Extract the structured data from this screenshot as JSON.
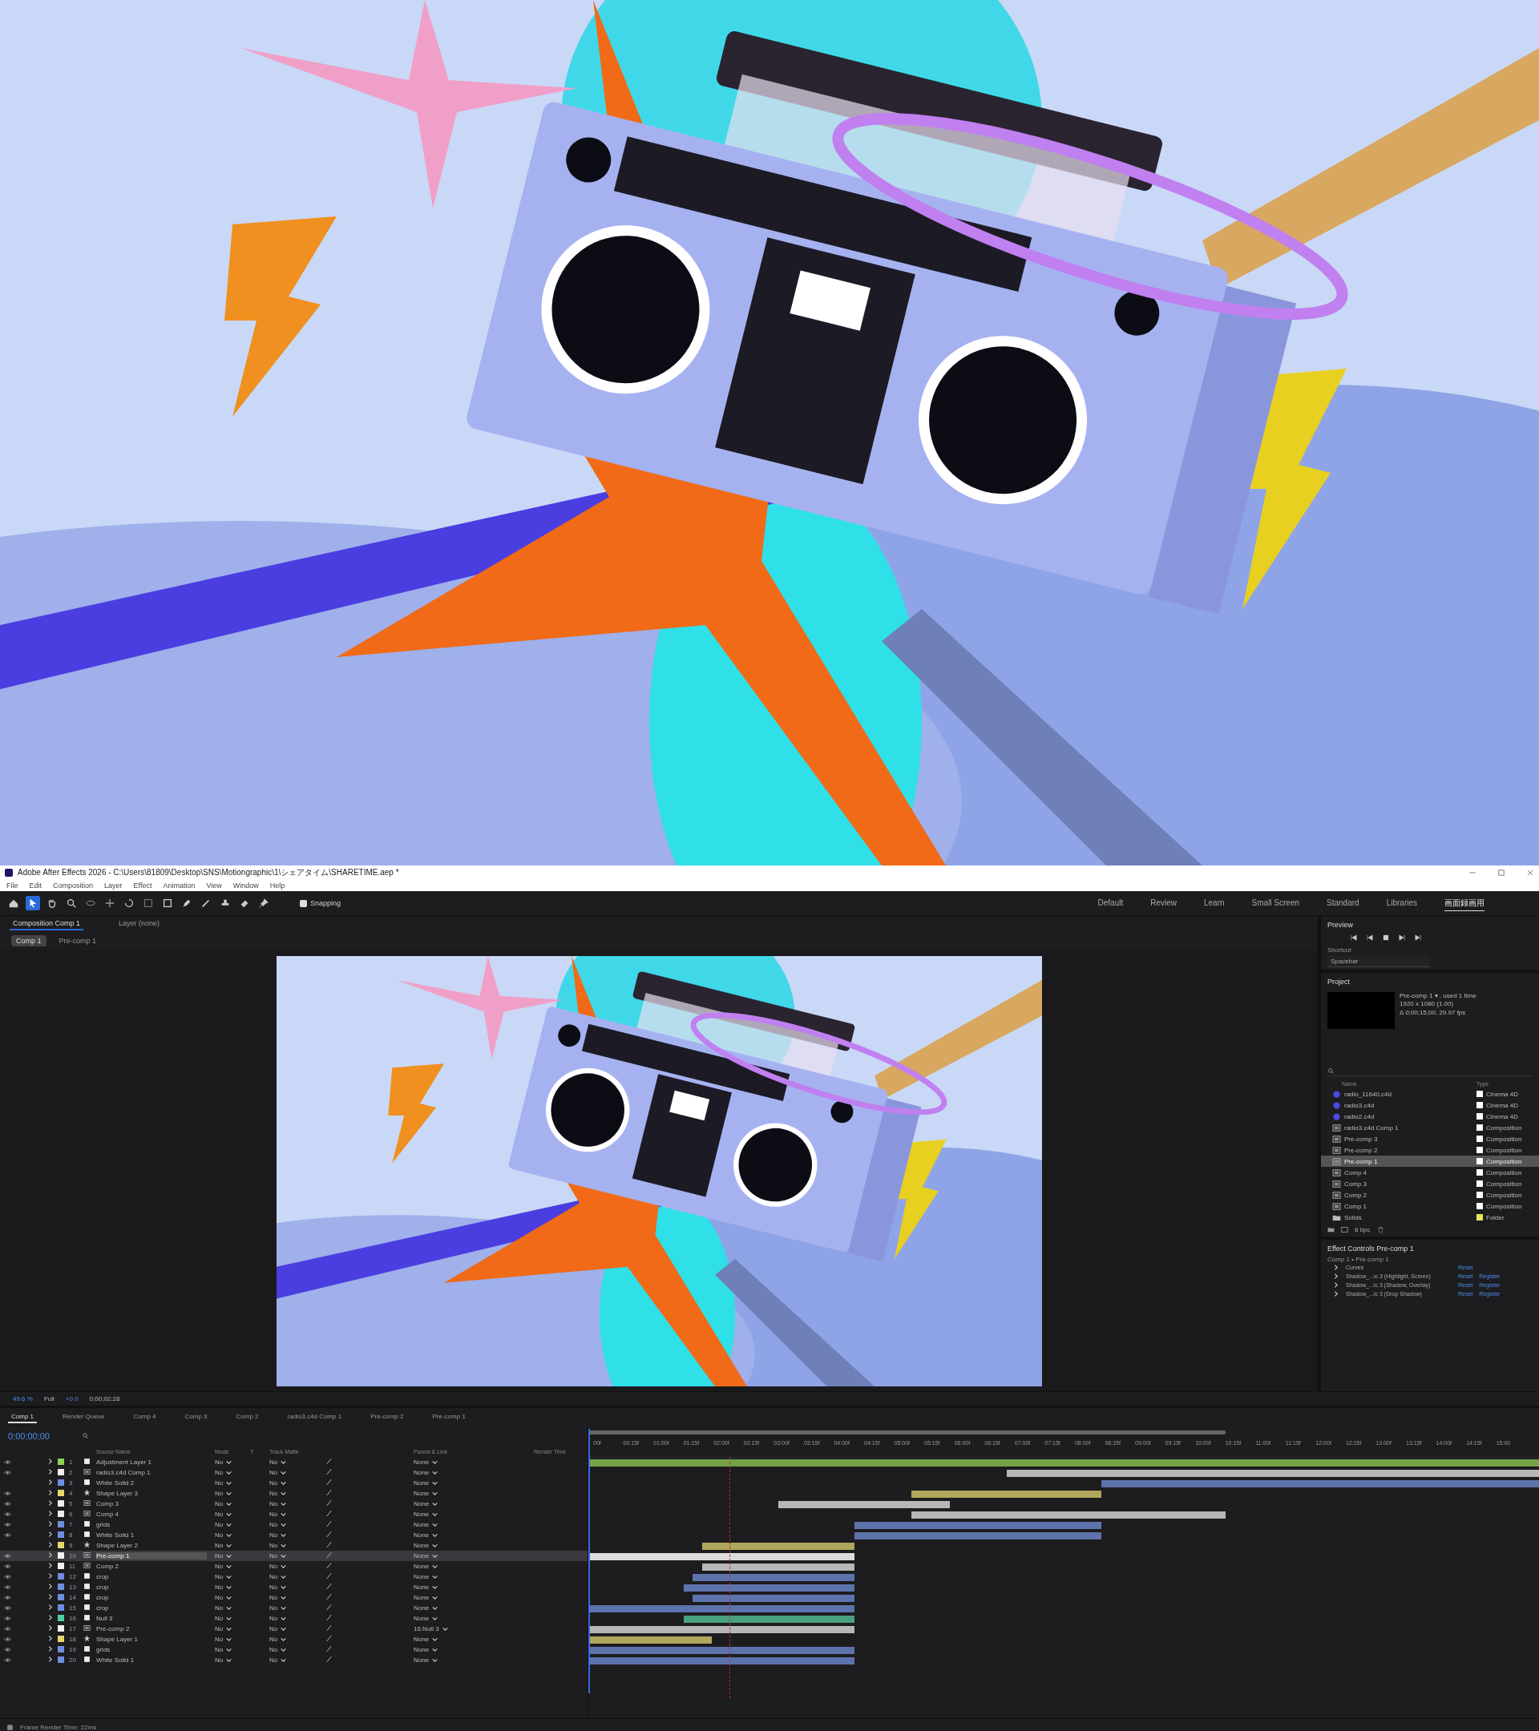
{
  "title_bar": {
    "app_title": "Adobe After Effects 2026 - C:\\Users\\81809\\Desktop\\SNS\\Motiongraphic\\1\\シェアタイム\\SHARETIME.aep *"
  },
  "menu": [
    "File",
    "Edit",
    "Composition",
    "Layer",
    "Effect",
    "Animation",
    "View",
    "Window",
    "Help"
  ],
  "toolbar": {
    "snapping": {
      "label": "Snapping",
      "checked": true
    }
  },
  "workspaces": [
    {
      "label": "Default",
      "selected": false
    },
    {
      "label": "Review",
      "selected": false
    },
    {
      "label": "Learn",
      "selected": false
    },
    {
      "label": "Small Screen",
      "selected": false
    },
    {
      "label": "Standard",
      "selected": false
    },
    {
      "label": "Libraries",
      "selected": false
    },
    {
      "label": "画面録画用",
      "selected": true
    }
  ],
  "composition_panel": {
    "tabs": [
      {
        "label": "Composition Comp 1",
        "selected": true
      },
      {
        "label": "Layer (none)",
        "selected": false
      }
    ],
    "breadcrumbs": [
      {
        "label": "Comp 1",
        "selected": true
      },
      {
        "label": "Pre-comp 1",
        "selected": false
      }
    ],
    "zoom": "49.6 %",
    "resolution": "Full",
    "exposure": "+0.0",
    "timecode": "0;00;02;28"
  },
  "preview_panel": {
    "title": "Preview",
    "shortcut_label": "Shortcut",
    "shortcut": "Spacebar"
  },
  "project_panel": {
    "title": "Project",
    "info": [
      "Pre-comp 1 ▾ , used 1 time",
      "1920 x 1080 (1.00)",
      "Δ 0;00;15;00, 29.97 fps"
    ],
    "columns": [
      "Name",
      "Type"
    ],
    "items": [
      {
        "name": "radio_11640.c4d",
        "type": "Cinema 4D",
        "kind": "c4d",
        "color": "#ffffff",
        "selected": false
      },
      {
        "name": "radio3.c4d",
        "type": "Cinema 4D",
        "kind": "c4d",
        "color": "#ffffff",
        "selected": false
      },
      {
        "name": "radio2.c4d",
        "type": "Cinema 4D",
        "kind": "c4d",
        "color": "#ffffff",
        "selected": false
      },
      {
        "name": "radio3.c4d Comp 1",
        "type": "Composition",
        "kind": "comp",
        "color": "#ffffff",
        "selected": false
      },
      {
        "name": "Pre-comp 3",
        "type": "Composition",
        "kind": "comp",
        "color": "#ffffff",
        "selected": false
      },
      {
        "name": "Pre-comp 2",
        "type": "Composition",
        "kind": "comp",
        "color": "#ffffff",
        "selected": false
      },
      {
        "name": "Pre-comp 1",
        "type": "Composition",
        "kind": "comp",
        "color": "#ffffff",
        "selected": true
      },
      {
        "name": "Comp 4",
        "type": "Composition",
        "kind": "comp",
        "color": "#ffffff",
        "selected": false
      },
      {
        "name": "Comp 3",
        "type": "Composition",
        "kind": "comp",
        "color": "#ffffff",
        "selected": false
      },
      {
        "name": "Comp 2",
        "type": "Composition",
        "kind": "comp",
        "color": "#ffffff",
        "selected": false
      },
      {
        "name": "Comp 1",
        "type": "Composition",
        "kind": "comp",
        "color": "#ffffff",
        "selected": false
      },
      {
        "name": "Solids",
        "type": "Folder",
        "kind": "folder",
        "color": "#e8e85a",
        "selected": false
      }
    ],
    "bpc": "8 bpc"
  },
  "effect_controls": {
    "title": "Effect Controls Pre-comp 1",
    "path": "Comp 1 • Pre-comp 1",
    "effects": [
      {
        "name": "Curves",
        "actions": [
          "Reset"
        ]
      },
      {
        "name": "Shadow_...ic 3 (Highlight, Screen)",
        "actions": [
          "Reset",
          "Register"
        ]
      },
      {
        "name": "Shadow_...ic 3 (Shadow, Overlay)",
        "actions": [
          "Reset",
          "Register"
        ]
      },
      {
        "name": "Shadow_...ic 3 (Drop Shadow)",
        "actions": [
          "Reset",
          "Register"
        ]
      }
    ]
  },
  "timeline": {
    "tabs": [
      {
        "label": "Comp 1",
        "selected": true
      },
      {
        "label": "Render Queue",
        "selected": false
      },
      {
        "label": "Comp 4",
        "selected": false
      },
      {
        "label": "Comp 3",
        "selected": false
      },
      {
        "label": "Comp 2",
        "selected": false
      },
      {
        "label": "radio3.c4d Comp 1",
        "selected": false
      },
      {
        "label": "Pre-comp 2",
        "selected": false
      },
      {
        "label": "Pre-comp 1",
        "selected": false
      }
    ],
    "timecode": "0;00;00;00",
    "columns": [
      "Source Name",
      "Mode",
      "T",
      "Track Matte",
      "Parent & Link",
      "Render Time"
    ],
    "ruler": [
      "00f",
      "00:15f",
      "01:00f",
      "01:15f",
      "02:00f",
      "02:15f",
      "03:00f",
      "03:15f",
      "04:00f",
      "04:15f",
      "05:00f",
      "05:15f",
      "06:00f",
      "06:15f",
      "07:00f",
      "07:15f",
      "08:00f",
      "08:15f",
      "09:00f",
      "09:15f",
      "10:00f",
      "10:15f",
      "11:00f",
      "11:15f",
      "12:00f",
      "12:15f",
      "13:00f",
      "13:15f",
      "14:00f",
      "14:15f",
      "15:00"
    ],
    "layers": [
      {
        "number": "1",
        "name": "Adjustment Layer 1",
        "kind": "solid",
        "color": "#8fd14f",
        "visible": true,
        "selected": false,
        "mode": "No",
        "track_matte": "No",
        "parent": "None"
      },
      {
        "number": "2",
        "name": "radio3.c4d Comp 1",
        "kind": "comp",
        "color": "#f0f0f0",
        "visible": true,
        "selected": false,
        "mode": "No",
        "track_matte": "No",
        "parent": "None"
      },
      {
        "number": "3",
        "name": "White Solid 2",
        "kind": "solid",
        "color": "#6e8fe0",
        "visible": false,
        "selected": false,
        "mode": "No",
        "track_matte": "No",
        "parent": "None"
      },
      {
        "number": "4",
        "name": "Shape Layer 3",
        "kind": "shape",
        "color": "#e6d86a",
        "visible": true,
        "selected": false,
        "mode": "No",
        "track_matte": "No",
        "parent": "None"
      },
      {
        "number": "5",
        "name": "Comp 3",
        "kind": "comp",
        "color": "#f0f0f0",
        "visible": true,
        "selected": false,
        "mode": "No",
        "track_matte": "No",
        "parent": "None"
      },
      {
        "number": "6",
        "name": "Comp 4",
        "kind": "comp",
        "color": "#f0f0f0",
        "visible": true,
        "selected": false,
        "mode": "No",
        "track_matte": "No",
        "parent": "None"
      },
      {
        "number": "7",
        "name": "grids",
        "kind": "solid",
        "color": "#6e8fe0",
        "visible": true,
        "selected": false,
        "mode": "No",
        "track_matte": "No",
        "parent": "None"
      },
      {
        "number": "8",
        "name": "White Solid 1",
        "kind": "solid",
        "color": "#6e8fe0",
        "visible": true,
        "selected": false,
        "mode": "No",
        "track_matte": "No",
        "parent": "None"
      },
      {
        "number": "9",
        "name": "Shape Layer 2",
        "kind": "shape",
        "color": "#e6d86a",
        "visible": false,
        "selected": false,
        "mode": "No",
        "track_matte": "No",
        "parent": "None"
      },
      {
        "number": "10",
        "name": "Pre-comp 1",
        "kind": "comp",
        "color": "#f0f0f0",
        "visible": true,
        "selected": true,
        "mode": "No",
        "track_matte": "No",
        "parent": "None"
      },
      {
        "number": "11",
        "name": "Comp 2",
        "kind": "comp",
        "color": "#f0f0f0",
        "visible": true,
        "selected": false,
        "mode": "No",
        "track_matte": "No",
        "parent": "None"
      },
      {
        "number": "12",
        "name": "crop",
        "kind": "solid",
        "color": "#6e8fe0",
        "visible": true,
        "selected": false,
        "mode": "No",
        "track_matte": "No",
        "parent": "None"
      },
      {
        "number": "13",
        "name": "crop",
        "kind": "solid",
        "color": "#6e8fe0",
        "visible": true,
        "selected": false,
        "mode": "No",
        "track_matte": "No",
        "parent": "None"
      },
      {
        "number": "14",
        "name": "crop",
        "kind": "solid",
        "color": "#6e8fe0",
        "visible": true,
        "selected": false,
        "mode": "No",
        "track_matte": "No",
        "parent": "None"
      },
      {
        "number": "15",
        "name": "crop",
        "kind": "solid",
        "color": "#6e8fe0",
        "visible": true,
        "selected": false,
        "mode": "No",
        "track_matte": "No",
        "parent": "None"
      },
      {
        "number": "16",
        "name": "Null 3",
        "kind": "solid",
        "color": "#4fd0a0",
        "visible": true,
        "selected": false,
        "mode": "No",
        "track_matte": "No",
        "parent": "None"
      },
      {
        "number": "17",
        "name": "Pre-comp 2",
        "kind": "comp",
        "color": "#f0f0f0",
        "visible": true,
        "selected": false,
        "mode": "No",
        "track_matte": "No",
        "parent": "16.Null 3"
      },
      {
        "number": "18",
        "name": "Shape Layer 1",
        "kind": "shape",
        "color": "#e6d86a",
        "visible": true,
        "selected": false,
        "mode": "No",
        "track_matte": "No",
        "parent": "None"
      },
      {
        "number": "19",
        "name": "grids",
        "kind": "solid",
        "color": "#6e8fe0",
        "visible": true,
        "selected": false,
        "mode": "No",
        "track_matte": "No",
        "parent": "None"
      },
      {
        "number": "20",
        "name": "White Solid 1",
        "kind": "solid",
        "color": "#6e8fe0",
        "visible": true,
        "selected": false,
        "mode": "No",
        "track_matte": "No",
        "parent": "None"
      }
    ],
    "status": "Frame Render Time: 22ms"
  }
}
